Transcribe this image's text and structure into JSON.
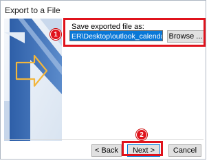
{
  "window": {
    "title": "Export to a File"
  },
  "form": {
    "label": "Save exported file as:",
    "path_value": "ER\\Desktop\\outlook_calendar_csv.csv",
    "browse_label": "Browse ..."
  },
  "footer": {
    "back_label": "< Back",
    "next_label": "Next >",
    "cancel_label": "Cancel"
  },
  "annotations": [
    {
      "label": "1"
    },
    {
      "label": "2"
    }
  ],
  "colors": {
    "highlight": "#e0131c",
    "selection": "#0a78d7",
    "graphic_blue": "#3d6fb5"
  }
}
